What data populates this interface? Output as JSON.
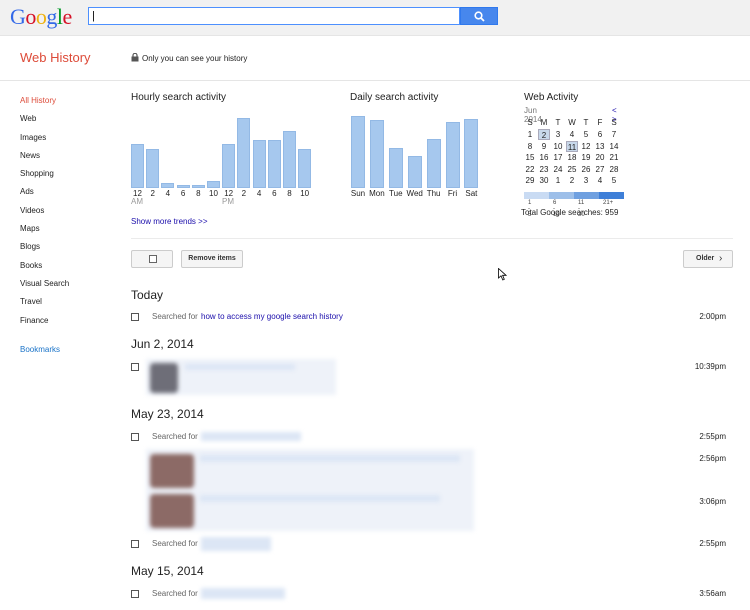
{
  "header": {
    "logo": "Google",
    "search_value": "|"
  },
  "page": {
    "title": "Web History",
    "privacy_note": "Only you can see your history"
  },
  "sidebar": {
    "items": [
      "All History",
      "Web",
      "Images",
      "News",
      "Shopping",
      "Ads",
      "Videos",
      "Maps",
      "Blogs",
      "Books",
      "Visual Search",
      "Travel",
      "Finance"
    ],
    "bookmarks": "Bookmarks"
  },
  "hourly": {
    "title": "Hourly search activity",
    "ticks": [
      "12",
      "2",
      "4",
      "6",
      "8",
      "10",
      "12",
      "2",
      "4",
      "6",
      "8",
      "10"
    ],
    "am": "AM",
    "pm": "PM",
    "values": [
      10,
      9,
      1.2,
      0.8,
      0.8,
      1.5,
      10,
      16,
      11,
      11,
      13,
      9
    ]
  },
  "daily": {
    "title": "Daily search activity",
    "ticks": [
      "Sun",
      "Mon",
      "Tue",
      "Wed",
      "Thu",
      "Fri",
      "Sat"
    ],
    "values": [
      10,
      9.5,
      5.5,
      4.5,
      6.8,
      9.2,
      9.6
    ]
  },
  "more_trends": "Show more trends >>",
  "calendar": {
    "title": "Web Activity",
    "month": "Jun 2014",
    "nav": "< >",
    "weekdays": [
      "S",
      "M",
      "T",
      "W",
      "T",
      "F",
      "S"
    ],
    "weeks": [
      [
        "1",
        "2",
        "3",
        "4",
        "5",
        "6",
        "7"
      ],
      [
        "8",
        "9",
        "10",
        "11",
        "12",
        "13",
        "14"
      ],
      [
        "15",
        "16",
        "17",
        "18",
        "19",
        "20",
        "21"
      ],
      [
        "22",
        "23",
        "24",
        "25",
        "26",
        "27",
        "28"
      ],
      [
        "29",
        "30",
        "1",
        "2",
        "3",
        "4",
        "5"
      ]
    ],
    "legend": [
      "1 - 5",
      "6 - 10",
      "11 - 20",
      "21+"
    ],
    "legend_colors": [
      "#c9dbf3",
      "#9dbfe9",
      "#6fa0e0",
      "#3e7fd8"
    ],
    "total": "Total Google searches: 959"
  },
  "toolbar": {
    "remove": "Remove items",
    "older": "Older"
  },
  "sections": [
    {
      "date": "Today",
      "entries": [
        {
          "label": "Searched for",
          "link": "how to access my google search history",
          "time": "2:00pm"
        }
      ]
    },
    {
      "date": "Jun 2, 2014",
      "entries": [
        {
          "time": "10:39pm"
        }
      ]
    },
    {
      "date": "May 23, 2014",
      "entries": [
        {
          "label": "Searched for",
          "time": "2:55pm"
        },
        {
          "time": "2:56pm"
        },
        {
          "time": "3:06pm"
        },
        {
          "label": "Searched for",
          "time": "2:55pm"
        }
      ]
    },
    {
      "date": "May 15, 2014",
      "entries": [
        {
          "label": "Searched for",
          "time": "3:56am"
        }
      ]
    }
  ]
}
